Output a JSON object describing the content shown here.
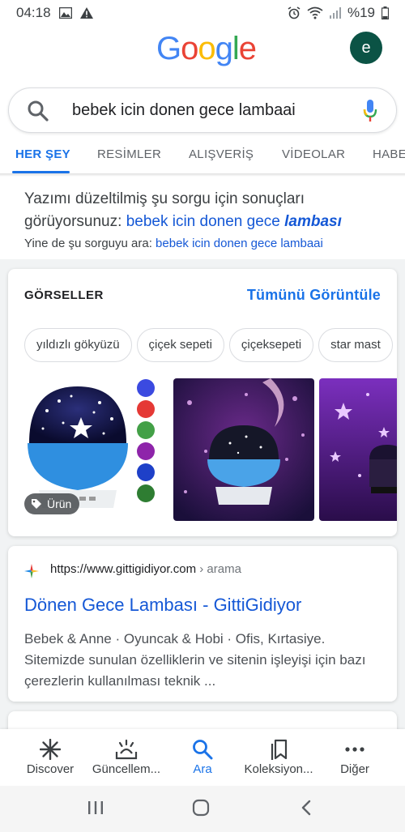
{
  "status_bar": {
    "time": "04:18",
    "battery": "%19"
  },
  "header": {
    "logo_letters": [
      {
        "ch": "G",
        "color": "#4285f4"
      },
      {
        "ch": "o",
        "color": "#ea4335"
      },
      {
        "ch": "o",
        "color": "#fbbc05"
      },
      {
        "ch": "g",
        "color": "#4285f4"
      },
      {
        "ch": "l",
        "color": "#34a853"
      },
      {
        "ch": "e",
        "color": "#ea4335"
      }
    ],
    "avatar_letter": "e",
    "avatar_color": "#0b5345"
  },
  "search": {
    "query": "bebek icin donen gece lambaai"
  },
  "tabs": [
    "HER ŞEY",
    "RESİMLER",
    "ALIŞVERİŞ",
    "VİDEOLAR",
    "HABE"
  ],
  "spelling": {
    "prefix": "Yazımı düzeltilmiş şu sorgu için sonuçları görüyorsunuz:",
    "corrected_plain": "bebek icin donen gece",
    "corrected_emph": "lambası",
    "instead_prefix": "Yine de şu sorguyu ara:",
    "instead_query": "bebek icin donen gece lambaai"
  },
  "images": {
    "title": "GÖRSELLER",
    "view_all": "Tümünü Görüntüle",
    "chips": [
      "yıldızlı gökyüzü",
      "çiçek sepeti",
      "çiçeksepeti",
      "star mast"
    ],
    "badge": "Ürün"
  },
  "result": {
    "url": "https://www.gittigidiyor.com",
    "crumb": "› arama",
    "title": "Dönen Gece Lambası - GittiGidiyor",
    "snippet": "Bebek & Anne · Oyuncak & Hobi · Ofis, Kırtasiye. Sitemizde sunulan özelliklerin ve sitenin işleyişi için bazı çerezlerin kullanılması teknik ..."
  },
  "bottom_nav": [
    "Discover",
    "Güncellem...",
    "Ara",
    "Koleksiyon...",
    "Diğer"
  ],
  "colors": {
    "accent": "#1a73e8",
    "link": "#1558d6"
  }
}
